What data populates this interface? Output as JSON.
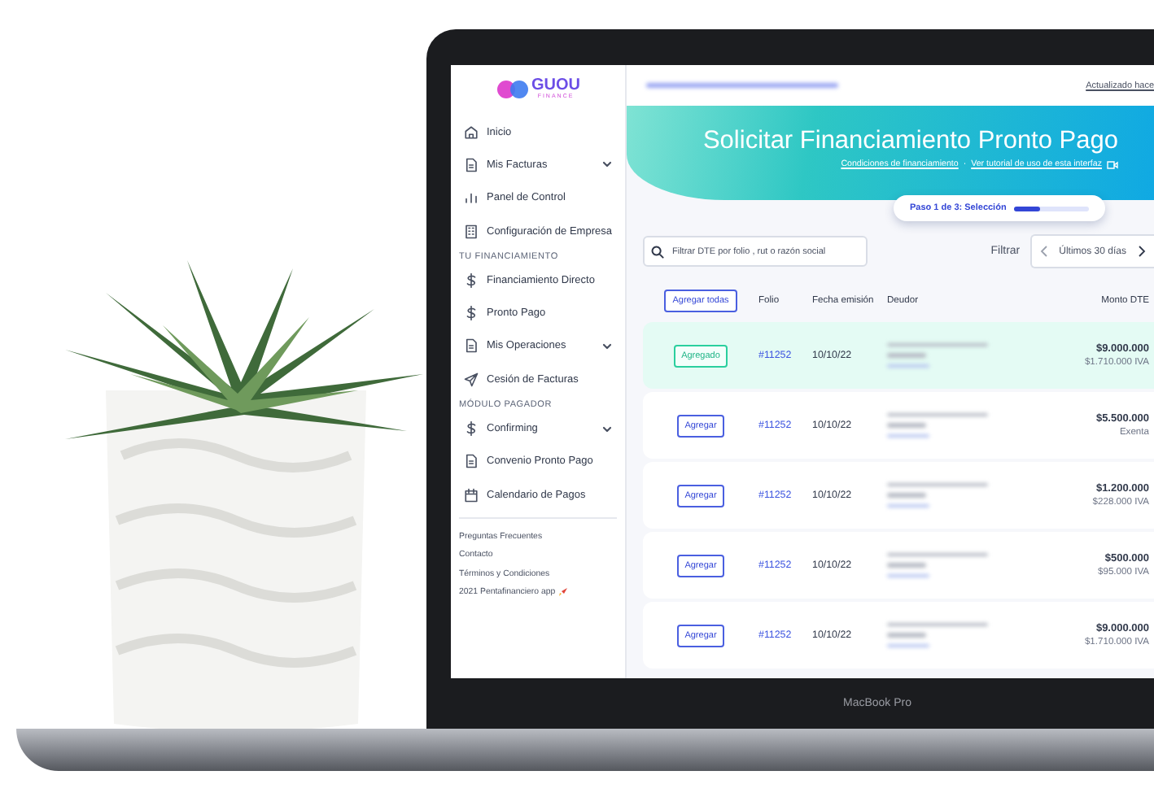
{
  "brand": {
    "name": "GUOU",
    "tagline": "FINANCE"
  },
  "sidebar": {
    "groups": [
      {
        "items": [
          {
            "label": "Inicio",
            "has_submenu": false
          },
          {
            "label": "Mis Facturas",
            "has_submenu": true
          },
          {
            "label": "Panel de Control",
            "has_submenu": false
          },
          {
            "label": "Configuración de Empresa",
            "has_submenu": false
          }
        ]
      },
      {
        "heading": "TU FINANCIAMIENTO",
        "items": [
          {
            "label": "Financiamiento Directo",
            "has_submenu": false
          },
          {
            "label": "Pronto Pago",
            "has_submenu": false
          },
          {
            "label": "Mis Operaciones",
            "has_submenu": true
          },
          {
            "label": "Cesión de Facturas",
            "has_submenu": false
          }
        ]
      },
      {
        "heading": "MÓDULO PAGADOR",
        "items": [
          {
            "label": "Confirming",
            "has_submenu": true
          },
          {
            "label": "Convenio Pronto Pago",
            "has_submenu": false
          },
          {
            "label": "Calendario de Pagos",
            "has_submenu": false
          }
        ]
      }
    ],
    "footer_links": [
      "Preguntas Frecuentes",
      "Contacto",
      "Términos y Condiciones",
      "2021 Pentafinanciero app"
    ]
  },
  "header": {
    "updated": "Actualizado hace"
  },
  "hero": {
    "title": "Solicitar Financiamiento Pronto Pago",
    "links": [
      "Condiciones de financiamiento",
      "Ver tutorial de uso de esta interfaz"
    ],
    "separator": "·",
    "step": {
      "label": "Paso 1 de 3: Selección",
      "level": 0.35
    }
  },
  "filters": {
    "search": {
      "placeholder": "Filtrar DTE por folio , rut o razón social"
    },
    "label": "Filtrar",
    "range": "Últimos 30 días"
  },
  "table": {
    "add_all": "Agregar todas",
    "columns": [
      "Folio",
      "Fecha emisión",
      "Deudor",
      "Monto DTE"
    ],
    "rows": [
      {
        "added": true,
        "action": "Agregado",
        "folio": "#11252",
        "date": "10/10/22",
        "amount": "$9.000.000",
        "tax": "$1.710.000 IVA"
      },
      {
        "added": false,
        "action": "Agregar",
        "folio": "#11252",
        "date": "10/10/22",
        "amount": "$5.500.000",
        "tax": "Exenta"
      },
      {
        "added": false,
        "action": "Agregar",
        "folio": "#11252",
        "date": "10/10/22",
        "amount": "$1.200.000",
        "tax": "$228.000 IVA"
      },
      {
        "added": false,
        "action": "Agregar",
        "folio": "#11252",
        "date": "10/10/22",
        "amount": "$500.000",
        "tax": "$95.000 IVA"
      },
      {
        "added": false,
        "action": "Agregar",
        "folio": "#11252",
        "date": "10/10/22",
        "amount": "$9.000.000",
        "tax": "$1.710.000 IVA"
      }
    ]
  },
  "laptop": {
    "model": "MacBook Pro"
  }
}
